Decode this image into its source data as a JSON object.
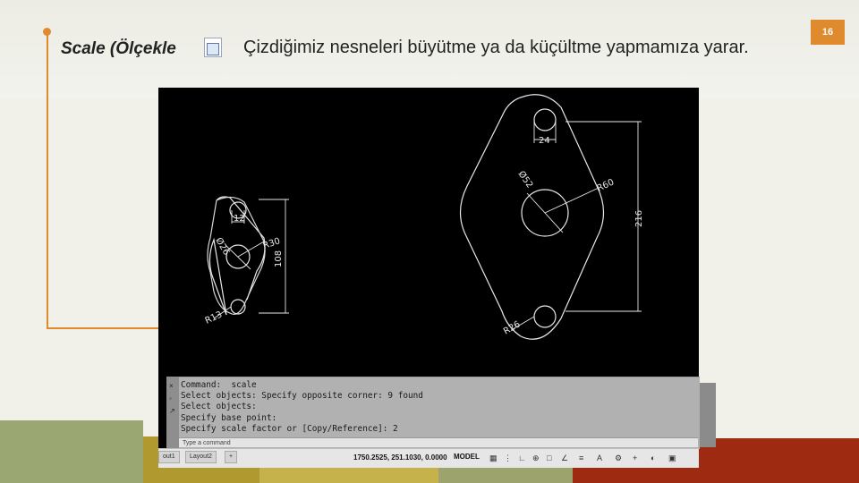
{
  "slide": {
    "page_number": "16",
    "heading": "Scale (Ölçekle",
    "description": "Çizdiğimiz nesneleri büyütme ya da küçültme yapmamıza yarar.",
    "colors": {
      "accent": "#e08a2e",
      "band_green": "#9aa772",
      "band_olive": "#b5a63a",
      "band_red": "#9e2a12"
    }
  },
  "cad": {
    "dimensions": {
      "small_width": "12",
      "small_diameter": "Ø26",
      "small_radius": "R30",
      "small_height": "108",
      "small_radius_bottom": "R13",
      "large_width": "24",
      "large_diameter": "Ø52",
      "large_radius": "R60",
      "large_height": "216",
      "large_radius_bottom": "R26"
    },
    "command_lines": [
      "Command:  scale",
      "Select objects: Specify opposite corner: 9 found",
      "Select objects:",
      "Specify base point:",
      "Specify scale factor or [Copy/Reference]: 2"
    ],
    "command_prompt": "Type a command",
    "side_icons": [
      "×",
      "◦",
      "↗"
    ],
    "tabs": [
      "out1",
      "Layout2",
      "+"
    ],
    "coordinates": "1750.2525, 251.1030, 0.0000",
    "model_label": "MODEL",
    "status_icons": [
      "grid-icon",
      "snap-icon",
      "ortho-icon",
      "polar-icon",
      "osnap-icon",
      "otrack-icon",
      "lineweight-icon",
      "annotation-icon",
      "workspace-icon",
      "settings-icon",
      "isolate-icon",
      "fullscreen-icon"
    ]
  }
}
